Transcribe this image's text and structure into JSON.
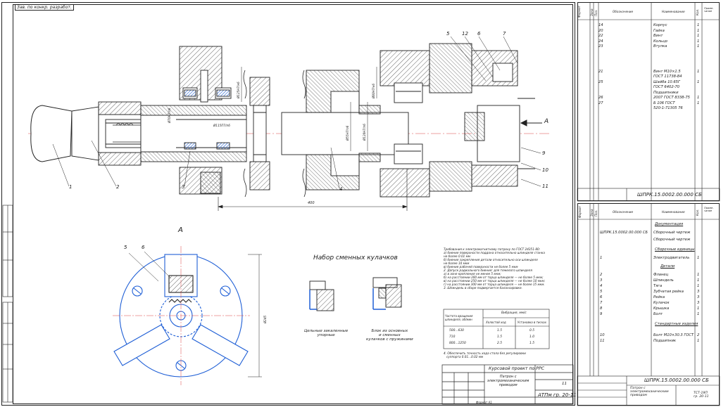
{
  "main": {
    "tag_top": "Зав. по конкр. разработ.",
    "view_label": "А",
    "arrow_label": "А",
    "dim_length": "400",
    "callouts_top": [
      "1",
      "2",
      "3",
      "4",
      "5",
      "12",
      "6",
      "7",
      "9",
      "10",
      "11"
    ],
    "callouts_view": [
      "5",
      "6"
    ],
    "dims_vertical": [
      "Ø125Н7/к6",
      "Ø70Н7/п6",
      "Ø115П7/п6",
      "Ø80Н7/к6",
      "Ø55Н7/п6",
      "Ø120Н7/п6"
    ],
    "view_dim": "Ø245"
  },
  "jaws": {
    "title": "Набор сменных кулачков",
    "left_caption": "Цельные закаленные\nупорные",
    "right_caption": "Блок из основных\nи сменных\nкулачков с пружинами"
  },
  "notes": {
    "lines": [
      "Требования к электромагнитному патрону по ГОСТ 24351-80:",
      "а) биение поверхности поддона относительно шпинделя станка",
      "     не более 0.01 мм",
      "б) биение закрепления детали относительно оси шпинделя",
      "     не более 10 мкм",
      "в) биение рабочей поверхности не более 5 мкм",
      "2. Допуск радиального биения: для тяжелого шпинделя",
      "   а) в зоне крепления не менее 5 мкм;",
      "   б) на расстоянии 300 мм от торца шпинделя — не более 5 мкм;",
      "   в) на расстоянии 250 мм от торца шпинделя — не более 10 мкм;",
      "   г) на расстоянии 300 мм от торца шпинделя — не более 15 мкм.",
      "3. Шпиндель в сборе подвергается балансировке."
    ],
    "table_header_left": "Частота вращения\nшпинделя, об/мин",
    "table_header_right": "Вибрация, мм/с",
    "table_subheaders": [
      "Холостой ход",
      "Установка в тисках"
    ],
    "table_rows": [
      [
        "500...630",
        "1.5",
        "0.5"
      ],
      [
        "710",
        "1.5",
        "1.0"
      ],
      [
        "800...1250",
        "2.5",
        "1.5"
      ]
    ],
    "note_bottom": "4. Обеспечить точность хода стола без регулировки\n   суппорта 0.01...0.02 мм"
  },
  "title_block_main": {
    "header_italic": "Курсовой проект по РРС",
    "doc_name": "Патрон с\nэлектромеханическим\nприводом",
    "sheet": "11",
    "group": "АТПм гр. 20-11",
    "format": "Формат А1"
  },
  "spec_top": {
    "headers": [
      "Формат",
      "Зона",
      "Поз.",
      "Обозначение",
      "Наименование",
      "Кол.",
      "Приме- чание"
    ],
    "rows": [
      {
        "pos": "14",
        "name": "Корпус",
        "qty": "1"
      },
      {
        "pos": "20",
        "name": "Гайка",
        "qty": "1"
      },
      {
        "pos": "22",
        "name": "Винт",
        "qty": "1"
      },
      {
        "pos": "24",
        "name": "Кольцо",
        "qty": "1"
      },
      {
        "pos": "23",
        "name": "Втулка",
        "qty": "1"
      },
      {
        "pos": "21",
        "name": "Винт М10×1.5",
        "qty": "1"
      },
      {
        "pos": "",
        "name": "ГОСТ 11738-84",
        "qty": ""
      },
      {
        "pos": "25",
        "name": "Шайба 10.65Г",
        "qty": "1"
      },
      {
        "pos": "",
        "name": "ГОСТ 6402-70",
        "qty": ""
      },
      {
        "pos": "",
        "name": "Подшипники",
        "qty": ""
      },
      {
        "pos": "26",
        "name": "2007 ГОСТ 8338-75",
        "qty": "1"
      },
      {
        "pos": "27",
        "name": "Б 106 ГОСТ",
        "qty": "1"
      },
      {
        "pos": "",
        "name": "520-1-71305 76",
        "qty": ""
      }
    ],
    "code": "ШПРК.15.0002.00.000 СБ"
  },
  "spec_bottom": {
    "headers": [
      "Формат",
      "Зона",
      "Поз.",
      "Обозначение",
      "Наименование",
      "Кол.",
      "Приме- чание"
    ],
    "rows": [
      {
        "pos": "",
        "code": "",
        "name": "Документация",
        "qty": ""
      },
      {
        "pos": "",
        "code": "ШПРК.15.0002.00.000 СБ",
        "name": "Сборочный чертеж",
        "qty": ""
      },
      {
        "pos": "",
        "code": "",
        "name": "Сборочный чертеж",
        "qty": ""
      },
      {
        "pos": "",
        "code": "",
        "name": "Сборочные единицы",
        "qty": ""
      },
      {
        "pos": "1",
        "code": "",
        "name": "Электродвигатель",
        "qty": "1"
      },
      {
        "pos": "",
        "code": "",
        "name": "Детали",
        "qty": ""
      },
      {
        "pos": "2",
        "code": "",
        "name": "Фланец",
        "qty": "1"
      },
      {
        "pos": "3",
        "code": "",
        "name": "Шпиндель",
        "qty": "1"
      },
      {
        "pos": "4",
        "code": "",
        "name": "Тяга",
        "qty": "1"
      },
      {
        "pos": "5",
        "code": "",
        "name": "Зубчатая рейка",
        "qty": "3"
      },
      {
        "pos": "6",
        "code": "",
        "name": "Рейка",
        "qty": "3"
      },
      {
        "pos": "7",
        "code": "",
        "name": "Кулачок",
        "qty": "3"
      },
      {
        "pos": "8",
        "code": "",
        "name": "Крышка",
        "qty": "1"
      },
      {
        "pos": "9",
        "code": "",
        "name": "Болт",
        "qty": "1"
      },
      {
        "pos": "",
        "code": "",
        "name": "Стандартные изделия",
        "qty": ""
      },
      {
        "pos": "10",
        "code": "",
        "name": "Болт М10×30.3 ГОСТ",
        "qty": "2"
      },
      {
        "pos": "11",
        "code": "",
        "name": "Подшипник",
        "qty": "1"
      }
    ],
    "code": "ШПРК.15.0002.00.000 СБ",
    "title": "Патрон с\nэлектромеханическим\nприводом",
    "group": "ТСТ-19П\nгр. 20-11"
  }
}
